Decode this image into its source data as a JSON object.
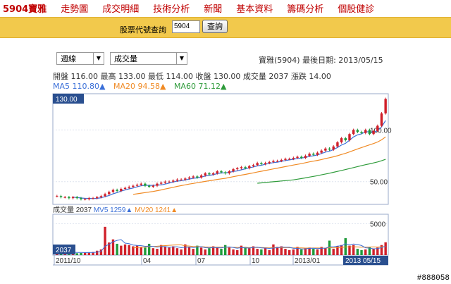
{
  "nav": {
    "items": [
      "5904寶雅",
      "走勢圖",
      "成交明細",
      "技術分析",
      "新聞",
      "基本資料",
      "籌碼分析",
      "個股健診"
    ]
  },
  "search": {
    "label": "股票代號查詢",
    "value": "5904",
    "button": "查詢"
  },
  "controls": {
    "period": "週線",
    "indicator": "成交量"
  },
  "stock_info": "寶雅(5904) 最後日期: 2013/05/15",
  "quote_line": "開盤 116.00 最高 133.00 最低 114.00 收盤 130.00 成交量 2037 漲跌 14.00",
  "ma": {
    "ma5": "MA5 110.80▲",
    "ma20": "MA20 94.58▲",
    "ma60": "MA60 71.12▲",
    "colors": {
      "ma5": "#3a6fd8",
      "ma20": "#f08a24",
      "ma60": "#2e9b3a"
    }
  },
  "price_chart": {
    "current_label": "130.00",
    "ticks": [
      "100.00",
      "50.00"
    ]
  },
  "volume_info": {
    "vol": "成交量 2037",
    "mv5": "MV5 1259▲",
    "mv20": "MV20 1241▲",
    "current_label": "2037",
    "tick": "5000"
  },
  "x_axis": {
    "labels": [
      "2011/10",
      "04",
      "07",
      "10",
      "2013/01"
    ],
    "end_label": "2013 05/15"
  },
  "watermark": "#888058",
  "chart_data": {
    "type": "candlestick",
    "x": [
      "2011/10",
      "04",
      "07",
      "10",
      "2013/01",
      "2013 05/15"
    ],
    "ylim_ticks": [
      50,
      100
    ],
    "last_close": 130.0,
    "price_series": [
      {
        "name": "MA5",
        "color": "#3a6fd8"
      },
      {
        "name": "MA20",
        "color": "#f08a24"
      },
      {
        "name": "MA60",
        "color": "#2e9b3a"
      }
    ],
    "close": [
      36,
      35,
      35,
      34,
      35,
      34,
      33,
      33,
      34,
      34,
      35,
      36,
      38,
      40,
      42,
      41,
      43,
      44,
      45,
      46,
      47,
      48,
      46,
      45,
      46,
      48,
      49,
      50,
      50,
      51,
      52,
      52,
      53,
      54,
      55,
      54,
      56,
      58,
      57,
      58,
      60,
      59,
      58,
      60,
      62,
      63,
      64,
      63,
      65,
      66,
      68,
      67,
      68,
      69,
      70,
      70,
      71,
      72,
      72,
      73,
      74,
      73,
      75,
      77,
      76,
      78,
      80,
      82,
      81,
      84,
      88,
      92,
      90,
      96,
      100,
      98,
      97,
      100,
      96,
      99,
      104,
      116,
      130
    ],
    "volume": [
      500,
      400,
      450,
      350,
      600,
      300,
      350,
      400,
      450,
      500,
      700,
      900,
      4500,
      2000,
      2500,
      1800,
      1500,
      1700,
      1600,
      1400,
      1500,
      1300,
      1200,
      1800,
      1100,
      1000,
      1600,
      1300,
      1200,
      1400,
      1100,
      900,
      1700,
      1300,
      1000,
      1500,
      1200,
      900,
      1100,
      1400,
      1300,
      1000,
      1600,
      1200,
      900,
      800,
      1500,
      1300,
      1100,
      1400,
      1000,
      900,
      1200,
      800,
      1700,
      1300,
      1400,
      1000,
      800,
      900,
      1300,
      900,
      1100,
      1200,
      1000,
      900,
      1300,
      1100,
      2300,
      1000,
      1400,
      1600,
      2700,
      1500,
      1600,
      1000,
      800,
      900,
      1300,
      1000,
      1200,
      1600,
      2037
    ]
  }
}
